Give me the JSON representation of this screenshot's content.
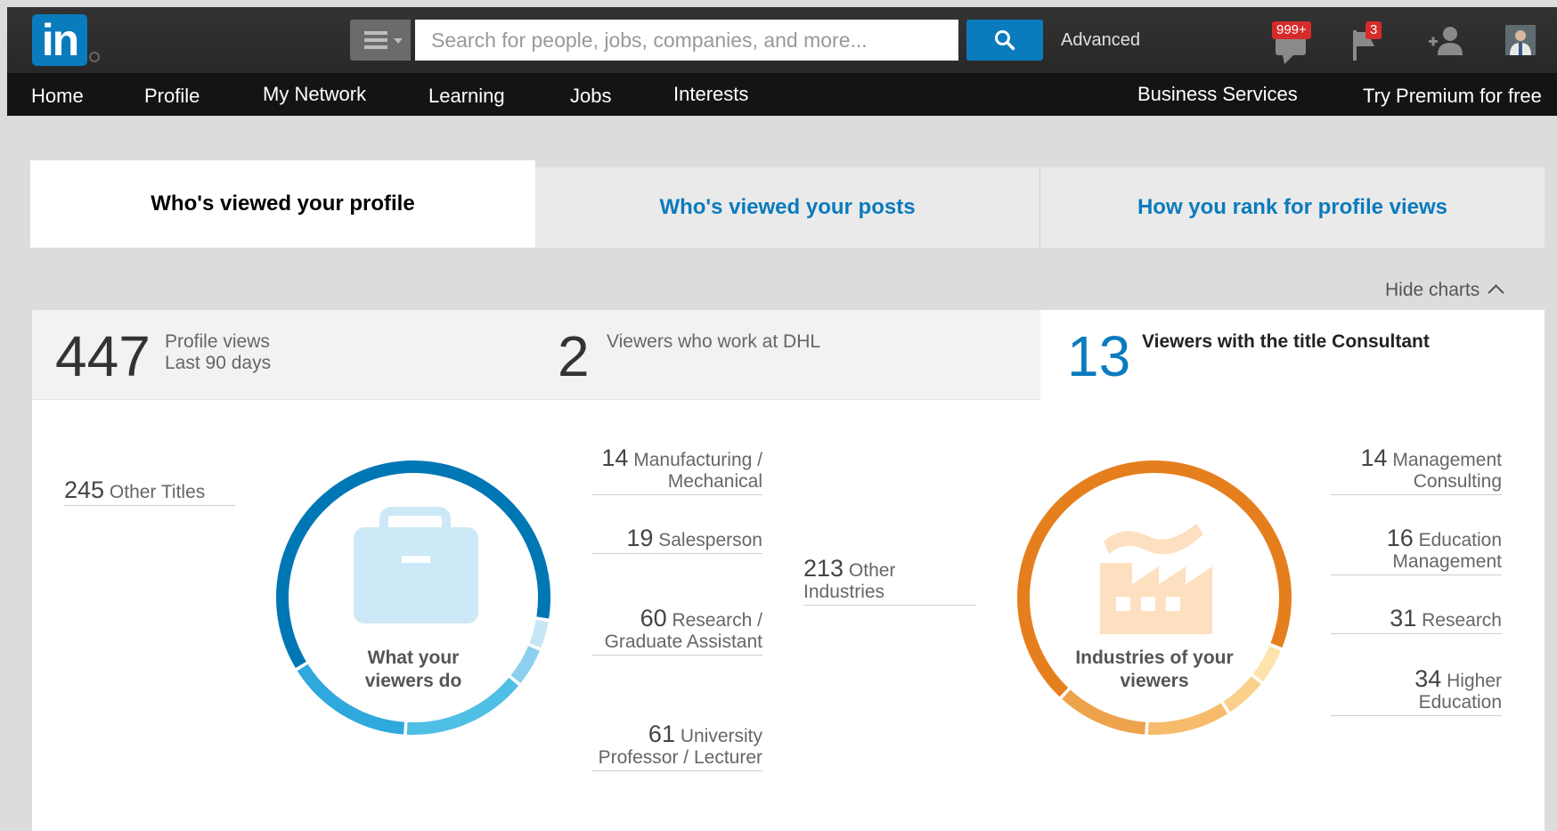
{
  "header": {
    "logo_text": "in",
    "search_placeholder": "Search for people, jobs, companies, and more...",
    "advanced_label": "Advanced",
    "messages_badge": "999+",
    "notifications_badge": "3",
    "icons": [
      "menu-icon",
      "search-icon",
      "messages-icon",
      "flag-icon",
      "add-connection-icon",
      "avatar"
    ]
  },
  "nav": {
    "items": [
      "Home",
      "Profile",
      "My Network",
      "Learning",
      "Jobs",
      "Interests"
    ],
    "right_items": [
      "Business Services",
      "Try Premium for free"
    ]
  },
  "tabs": [
    {
      "label": "Who's viewed your profile",
      "active": true
    },
    {
      "label": "Who's viewed your posts",
      "active": false
    },
    {
      "label": "How you rank for profile views",
      "active": false
    }
  ],
  "hide_charts_label": "Hide charts",
  "stats": {
    "views": {
      "value": "447",
      "label1": "Profile views",
      "label2": "Last 90 days"
    },
    "company": {
      "value": "2",
      "label": "Viewers who work at DHL"
    },
    "title": {
      "value": "13",
      "label": "Viewers with the title Consultant"
    }
  },
  "chart_data": [
    {
      "type": "pie",
      "title": "What your viewers do",
      "categories": [
        "Other Titles",
        "Manufacturing / Mechanical",
        "Salesperson",
        "Research / Graduate Assistant",
        "University Professor / Lecturer"
      ],
      "values": [
        245,
        14,
        19,
        60,
        61
      ],
      "colors": [
        "#0077b5",
        "#c7e6f5",
        "#8dcfee",
        "#4fbfe6",
        "#2ea8dd"
      ]
    },
    {
      "type": "pie",
      "title": "Industries of your viewers",
      "categories": [
        "Other Industries",
        "Management Consulting",
        "Education Management",
        "Research",
        "Higher Education"
      ],
      "values": [
        213,
        14,
        16,
        31,
        34
      ],
      "colors": [
        "#e57f1d",
        "#fde4ad",
        "#fbd08a",
        "#f6bb6b",
        "#eda34c"
      ]
    }
  ],
  "legends": {
    "titles": {
      "center": [
        "What your",
        "viewers do"
      ],
      "other": {
        "n": "245",
        "label": "Other Titles"
      },
      "items": [
        {
          "n": "14",
          "label1": "Manufacturing /",
          "label2": "Mechanical"
        },
        {
          "n": "19",
          "label1": "Salesperson",
          "label2": ""
        },
        {
          "n": "60",
          "label1": "Research /",
          "label2": "Graduate Assistant"
        },
        {
          "n": "61",
          "label1": "University",
          "label2": "Professor / Lecturer"
        }
      ]
    },
    "industries": {
      "center": [
        "Industries of your",
        "viewers"
      ],
      "other": {
        "n": "213",
        "label1": "Other",
        "label2": "Industries"
      },
      "items": [
        {
          "n": "14",
          "label1": "Management",
          "label2": "Consulting"
        },
        {
          "n": "16",
          "label1": "Education",
          "label2": "Management"
        },
        {
          "n": "31",
          "label1": "Research",
          "label2": ""
        },
        {
          "n": "34",
          "label1": "Higher",
          "label2": "Education"
        }
      ]
    }
  }
}
